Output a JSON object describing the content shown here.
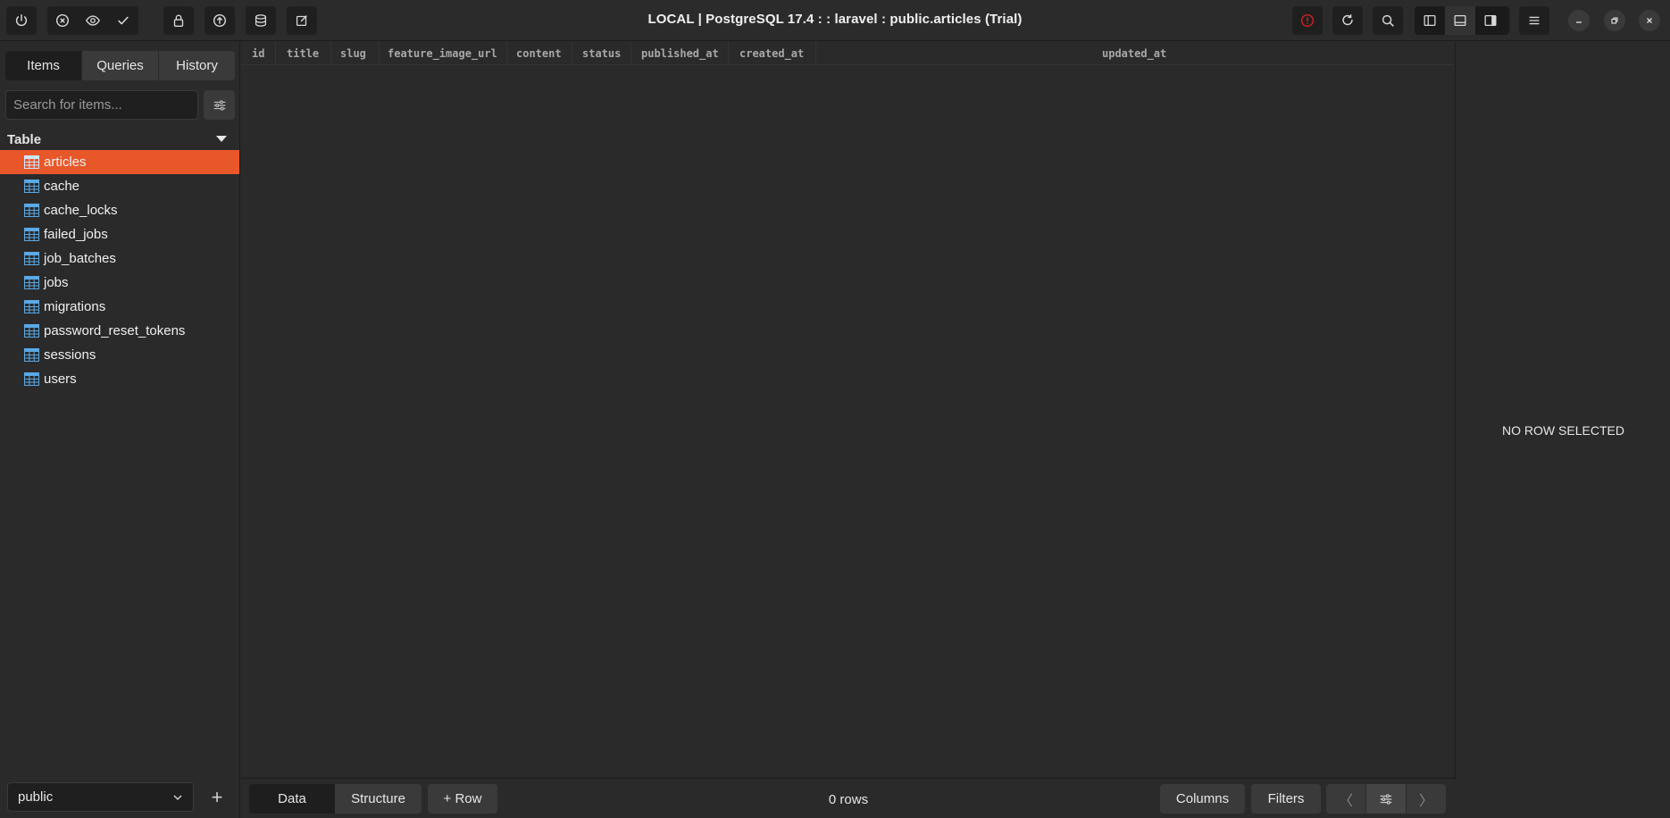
{
  "window": {
    "title": "LOCAL | PostgreSQL 17.4 :   : laravel  : public.articles (Trial)"
  },
  "toolbar": {
    "left_icons": [
      "power-icon",
      "close-circle-icon",
      "eye-icon",
      "check-icon",
      "lock-icon",
      "upload-circle-icon",
      "database-icon",
      "edit-icon"
    ],
    "right_icons": [
      "alert-icon",
      "refresh-icon",
      "search-icon",
      "sidebar-left-icon",
      "panel-bottom-icon",
      "sidebar-right-icon",
      "menu-icon"
    ],
    "window_controls": [
      "minimize-icon",
      "restore-icon",
      "close-icon"
    ],
    "alert_color": "#d02020"
  },
  "sidebar": {
    "tabs": [
      {
        "label": "Items",
        "active": true
      },
      {
        "label": "Queries",
        "active": false
      },
      {
        "label": "History",
        "active": false
      }
    ],
    "search": {
      "placeholder": "Search for items...",
      "value": ""
    },
    "section_title": "Table",
    "tables": [
      {
        "name": "articles",
        "selected": true
      },
      {
        "name": "cache",
        "selected": false
      },
      {
        "name": "cache_locks",
        "selected": false
      },
      {
        "name": "failed_jobs",
        "selected": false
      },
      {
        "name": "job_batches",
        "selected": false
      },
      {
        "name": "jobs",
        "selected": false
      },
      {
        "name": "migrations",
        "selected": false
      },
      {
        "name": "password_reset_tokens",
        "selected": false
      },
      {
        "name": "sessions",
        "selected": false
      },
      {
        "name": "users",
        "selected": false
      }
    ],
    "schema": "public",
    "add_label": "+"
  },
  "grid": {
    "columns": [
      "id",
      "title",
      "slug",
      "feature_image_url",
      "content",
      "status",
      "published_at",
      "created_at",
      "updated_at"
    ],
    "rows": []
  },
  "bottom": {
    "view_tabs": [
      {
        "label": "Data",
        "active": true
      },
      {
        "label": "Structure",
        "active": false
      }
    ],
    "add_row": "+ Row",
    "row_count": "0 rows",
    "columns_btn": "Columns",
    "filters_btn": "Filters",
    "pager": {
      "prev": "〈",
      "next": "〉"
    }
  },
  "detail": {
    "empty_text": "NO ROW SELECTED"
  },
  "colors": {
    "accent": "#e8572a",
    "table_icon": "#5aa9e6",
    "background": "#2a2a2a"
  }
}
